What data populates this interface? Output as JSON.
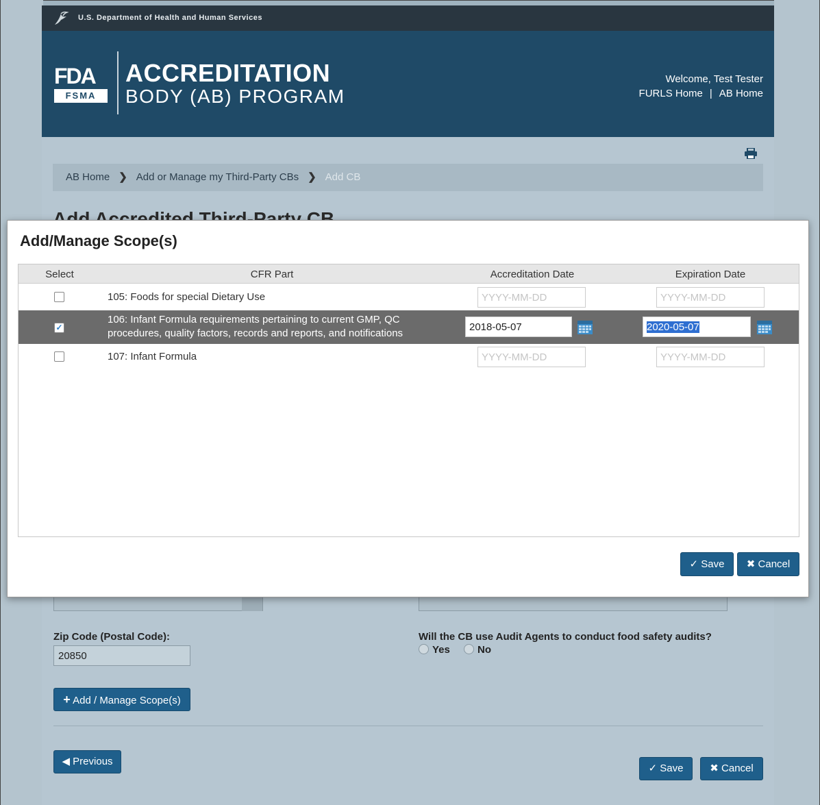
{
  "gov_bar": {
    "text": "U.S. Department of Health and Human Services"
  },
  "banner": {
    "logo_letters": "FDA",
    "logo_sub": "FSMA",
    "title_line1": "ACCREDITATION",
    "title_line2": "BODY (AB) PROGRAM",
    "welcome": "Welcome, Test Tester",
    "furls_home": "FURLS Home",
    "separator": "|",
    "ab_home": "AB Home"
  },
  "breadcrumb": {
    "items": [
      "AB Home",
      "Add or Manage my Third-Party CBs"
    ],
    "current": "Add CB"
  },
  "page": {
    "heading": "Add Accredited Third-Party CB",
    "zip_label": "Zip Code (Postal Code):",
    "zip_value": "20850",
    "audit_question": "Will the CB use Audit Agents to conduct food safety audits?",
    "yes_label": "Yes",
    "no_label": "No",
    "add_scope_label": "Add / Manage Scope(s)",
    "previous_label": "Previous",
    "save_label": "Save",
    "cancel_label": "Cancel"
  },
  "modal": {
    "title": "Add/Manage Scope(s)",
    "columns": {
      "select": "Select",
      "cfr_part": "CFR Part",
      "accreditation_date": "Accreditation Date",
      "expiration_date": "Expiration Date"
    },
    "rows": [
      {
        "checked": false,
        "cfr": "105: Foods for special Dietary Use",
        "accreditation": "",
        "expiration": ""
      },
      {
        "checked": true,
        "cfr": "106: Infant Formula requirements pertaining to current GMP, QC procedures, quality factors, records and reports, and notifications",
        "accreditation": "2018-05-07",
        "expiration": "2020-05-07"
      },
      {
        "checked": false,
        "cfr": "107: Infant Formula",
        "accreditation": "",
        "expiration": ""
      }
    ],
    "date_placeholder": "YYYY-MM-DD",
    "save_label": "Save",
    "cancel_label": "Cancel"
  },
  "colors": {
    "banner": "#1f4a67",
    "gov_bar": "#293640",
    "button": "#1f5f8b",
    "selected_row": "#6b6b6b"
  }
}
